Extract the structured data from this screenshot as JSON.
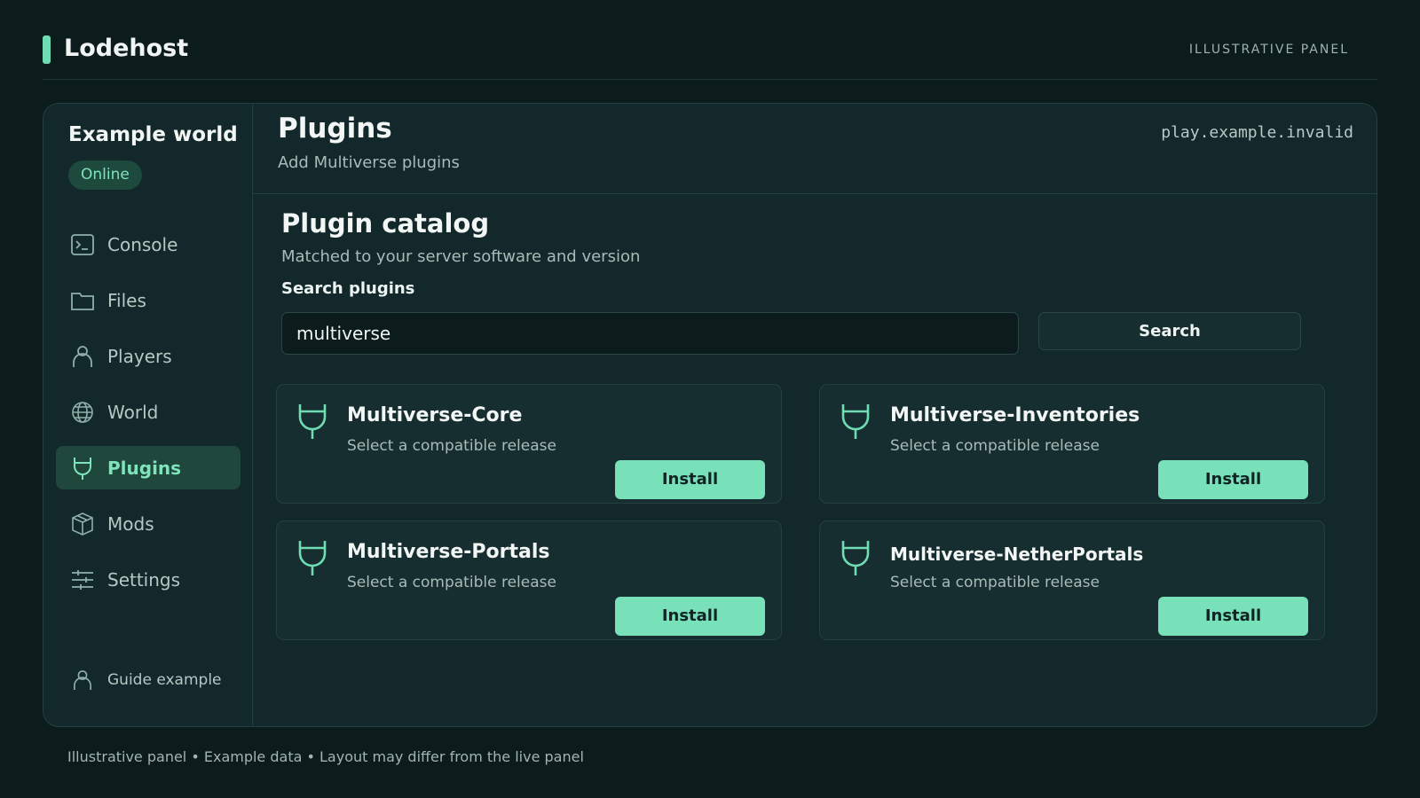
{
  "brand": {
    "name": "Lodehost",
    "tag": "ILLUSTRATIVE PANEL"
  },
  "colors": {
    "accent": "#78e1ba",
    "background": "#0c1b1c",
    "panel": "#12282a"
  },
  "sidebar": {
    "world_name": "Example world",
    "status": "Online",
    "items": [
      {
        "label": "Console",
        "icon": "console-icon"
      },
      {
        "label": "Files",
        "icon": "folder-icon"
      },
      {
        "label": "Players",
        "icon": "user-icon"
      },
      {
        "label": "World",
        "icon": "globe-icon"
      },
      {
        "label": "Plugins",
        "icon": "plug-icon",
        "active": true
      },
      {
        "label": "Mods",
        "icon": "box-icon"
      },
      {
        "label": "Settings",
        "icon": "sliders-icon"
      }
    ],
    "guide": {
      "label": "Guide example",
      "icon": "user-icon"
    }
  },
  "header": {
    "title": "Plugins",
    "subtitle": "Add Multiverse plugins",
    "host": "play.example.invalid"
  },
  "catalog": {
    "title": "Plugin catalog",
    "subtitle": "Matched to your server software and version",
    "search_label": "Search plugins",
    "search_value": "multiverse",
    "search_button": "Search",
    "plugins": [
      {
        "name": "Multiverse-Core",
        "desc": "Select a compatible release",
        "action": "Install"
      },
      {
        "name": "Multiverse-Inventories",
        "desc": "Select a compatible release",
        "action": "Install"
      },
      {
        "name": "Multiverse-Portals",
        "desc": "Select a compatible release",
        "action": "Install"
      },
      {
        "name": "Multiverse-NetherPortals",
        "desc": "Select a compatible release",
        "action": "Install"
      }
    ]
  },
  "footer": {
    "note": "Illustrative panel • Example data • Layout may differ from the live panel"
  }
}
